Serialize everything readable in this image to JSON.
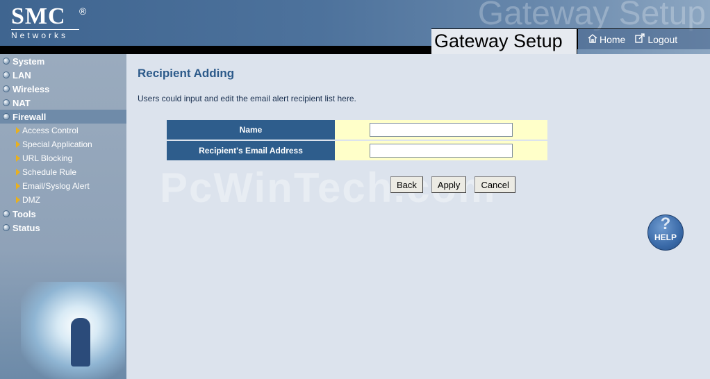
{
  "header": {
    "logo_main": "SMC",
    "logo_reg": "®",
    "logo_sub": "Networks",
    "ghost_text": "Gateway Setup",
    "title": "Gateway  Setup",
    "home_label": "Home",
    "logout_label": "Logout"
  },
  "sidebar": {
    "items": [
      {
        "label": "System"
      },
      {
        "label": "LAN"
      },
      {
        "label": "Wireless"
      },
      {
        "label": "NAT"
      },
      {
        "label": "Firewall"
      },
      {
        "label": "Tools"
      },
      {
        "label": "Status"
      }
    ],
    "firewall_sub": [
      {
        "label": "Access Control"
      },
      {
        "label": "Special Application"
      },
      {
        "label": "URL Blocking"
      },
      {
        "label": "Schedule Rule"
      },
      {
        "label": "Email/Syslog Alert"
      },
      {
        "label": "DMZ"
      }
    ]
  },
  "main": {
    "title": "Recipient Adding",
    "description": "Users could input and edit the email alert recipient list here.",
    "fields": [
      {
        "label": "Name",
        "value": ""
      },
      {
        "label": "Recipient's Email Address",
        "value": ""
      }
    ],
    "buttons": {
      "back": "Back",
      "apply": "Apply",
      "cancel": "Cancel"
    },
    "watermark": "PcWinTech.com",
    "help": {
      "glyph": "?",
      "label": "HELP"
    }
  },
  "colors": {
    "accent": "#2e5d8c",
    "field_bg": "#ffffc9",
    "content_bg": "#dce3ed"
  }
}
